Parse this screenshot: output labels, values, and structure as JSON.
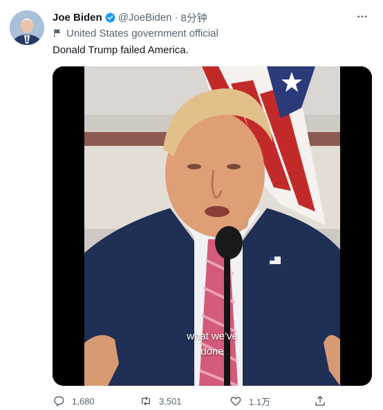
{
  "tweet": {
    "author_name": "Joe Biden",
    "handle": "@JoeBiden",
    "separator": "·",
    "time": "8分钟",
    "account_label": "United States government official",
    "text": "Donald Trump failed America.",
    "video_caption_line1": "what we've",
    "video_caption_line2": "done"
  },
  "actions": {
    "replies": "1,680",
    "retweets": "3,501",
    "likes": "1.1万"
  },
  "icons": {
    "verified": "verified-badge-icon",
    "label": "flag-icon",
    "more": "more-dots-icon",
    "reply": "reply-icon",
    "retweet": "retweet-icon",
    "like": "heart-icon",
    "share": "share-icon"
  },
  "colors": {
    "verified_blue": "#1d9bf0",
    "secondary_text": "#536471",
    "primary_text": "#0f1419"
  }
}
